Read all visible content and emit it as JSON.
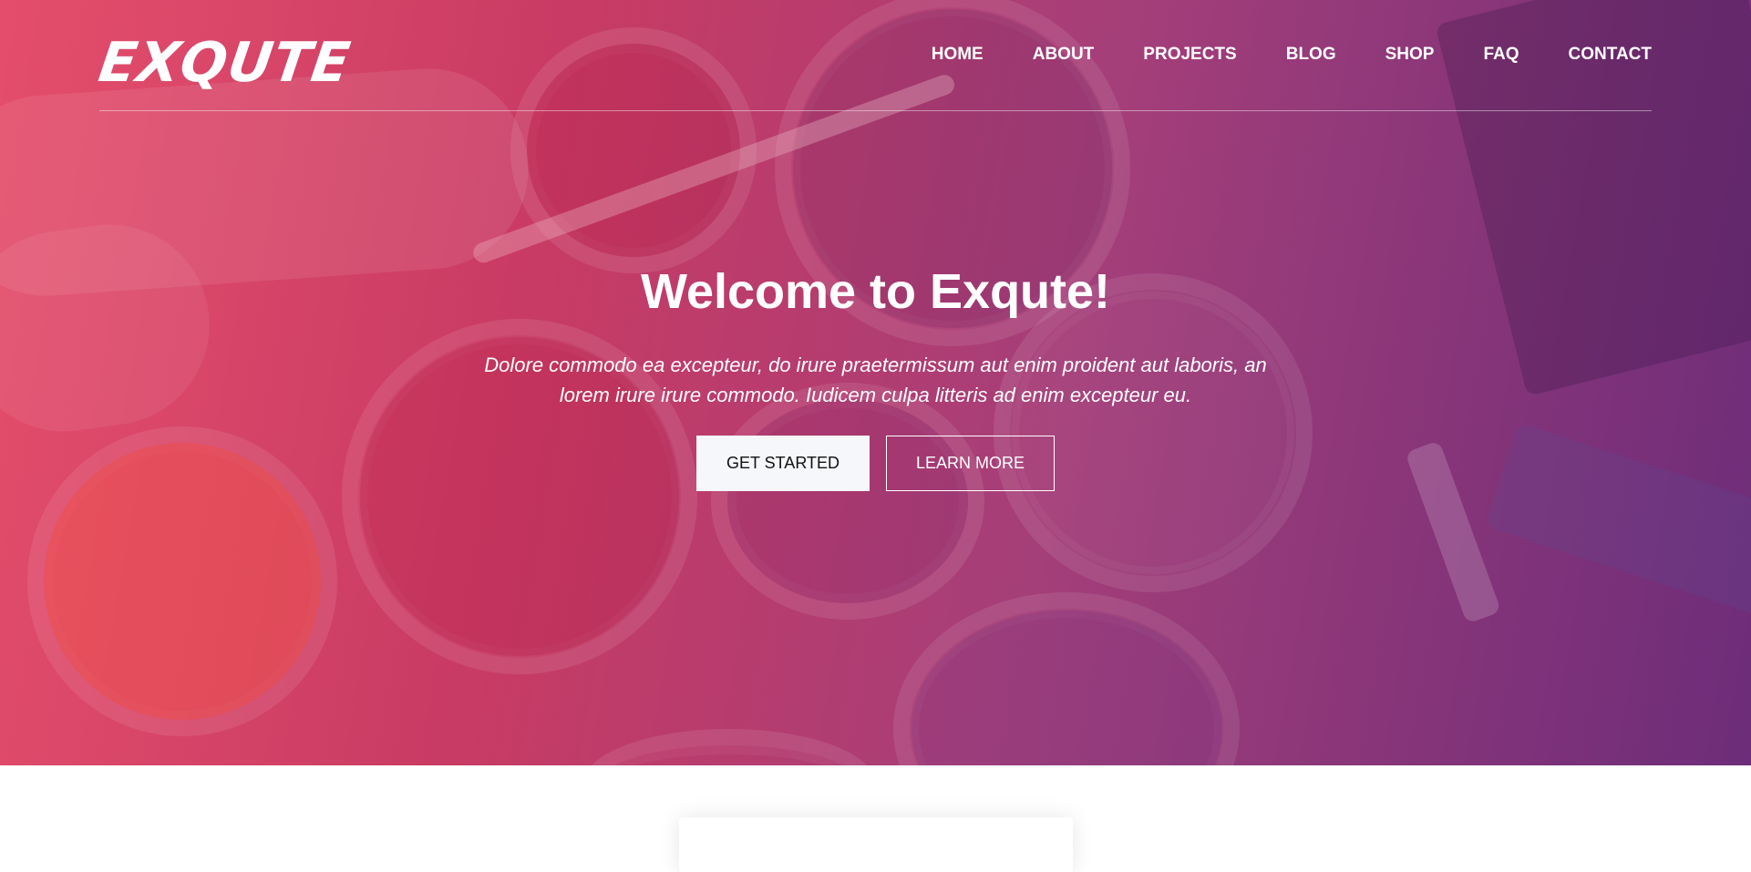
{
  "brand": {
    "logo_text": "EXQUTE"
  },
  "nav": {
    "items": [
      {
        "label": "HOME"
      },
      {
        "label": "ABOUT"
      },
      {
        "label": "PROJECTS"
      },
      {
        "label": "BLOG"
      },
      {
        "label": "SHOP"
      },
      {
        "label": "FAQ"
      },
      {
        "label": "CONTACT"
      }
    ]
  },
  "hero": {
    "title": "Welcome to Exqute!",
    "text": "Dolore commodo ea excepteur, do irure praetermissum aut enim proident aut laboris, an lorem irure irure commodo. Iudicem culpa litteris ad enim excepteur eu.",
    "primary_button": "GET STARTED",
    "secondary_button": "LEARN MORE"
  },
  "colors": {
    "gradient_start": "#e24d6a",
    "gradient_end": "#6d2f7a",
    "button_primary_bg": "#f6f7fa"
  }
}
